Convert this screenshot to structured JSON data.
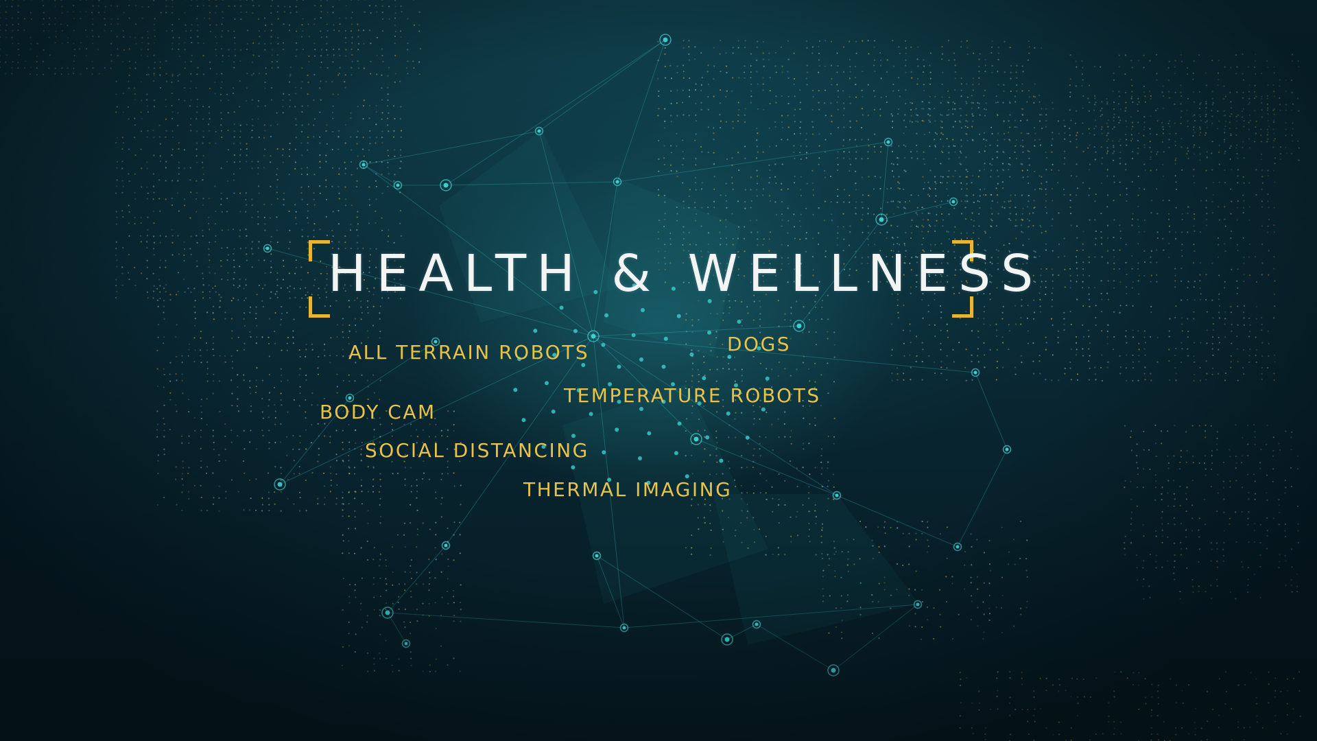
{
  "title": "HEALTH & WELLNESS",
  "tags": [
    "ALL TERRAIN ROBOTS",
    "DOGS",
    "TEMPERATURE ROBOTS",
    "BODY CAM",
    "SOCIAL DISTANCING",
    "THERMAL IMAGING"
  ],
  "colors": {
    "accent": "#e7b52f",
    "tag_text": "#e9c24a",
    "title_text": "#f2f5f4",
    "network": "#3ccfd0",
    "background": "#0a2a35"
  }
}
